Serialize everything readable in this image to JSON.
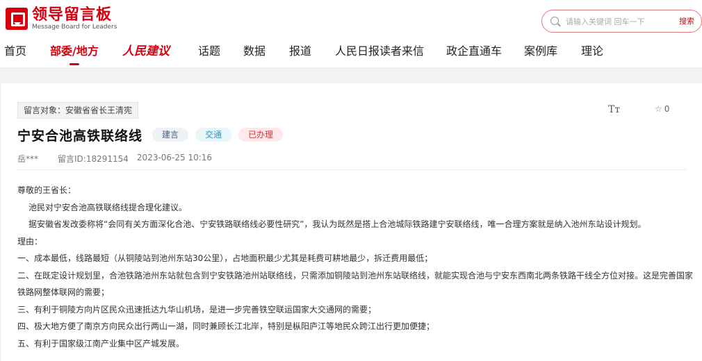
{
  "logo": {
    "cn": "领导留言板",
    "en": "Message Board for Leaders"
  },
  "search": {
    "placeholder": "请输入关键词 回车一下",
    "button": "搜索"
  },
  "nav": [
    {
      "label": "首页"
    },
    {
      "label": "部委/地方"
    },
    {
      "label": "人民建议"
    },
    {
      "label": "话题"
    },
    {
      "label": "数据"
    },
    {
      "label": "报道"
    },
    {
      "label": "人民日报读者来信"
    },
    {
      "label": "政企直通车"
    },
    {
      "label": "案例库"
    },
    {
      "label": "理论"
    }
  ],
  "post": {
    "target": "留言对象：安徽省省长王清宪",
    "font_toggle": "Tт",
    "star_count": "0",
    "title": "宁安合池高铁联络线",
    "tags": [
      "建言",
      "交通",
      "已办理"
    ],
    "author": "岳***",
    "message_id": "留言ID:18291154",
    "datetime": "2023-06-25 10:16",
    "paragraphs": [
      "尊敬的王省长：",
      "池民对宁安合池高铁联络线提合理化建议。",
      "据安徽省发改委称将“会同有关方面深化合池、宁安铁路联络线必要性研究”，我认为既然是搭上合池城际铁路建宁安联络线，唯一合理方案就是纳入池州东站设计规划。",
      "理由：",
      "一、成本最低，线路最短（从铜陵站到池州东站30公里），占地面积最少尤其是耗费可耕地最少，拆迁费用最低；",
      "二、在既定设计规划里，合池铁路池州东站就包含到宁安铁路池州站联络线，只需添加铜陵站到池州东站联络线，就能实现合池与宁安东西南北两条铁路干线全方位对接。这是完善国家铁路网整体联网的需要；",
      "三、有利于铜陵方向片区民众迅速抵达九华山机场，是进一步完善铁空联运国家大交通网的需要；",
      "四、极大地方便了南京方向民众出行两山一湖，同时兼顾长江北岸，特别是枞阳庐江等地民众跨江出行更加便捷；",
      "五、有利于国家级江南产业集中区产城发展。"
    ]
  }
}
